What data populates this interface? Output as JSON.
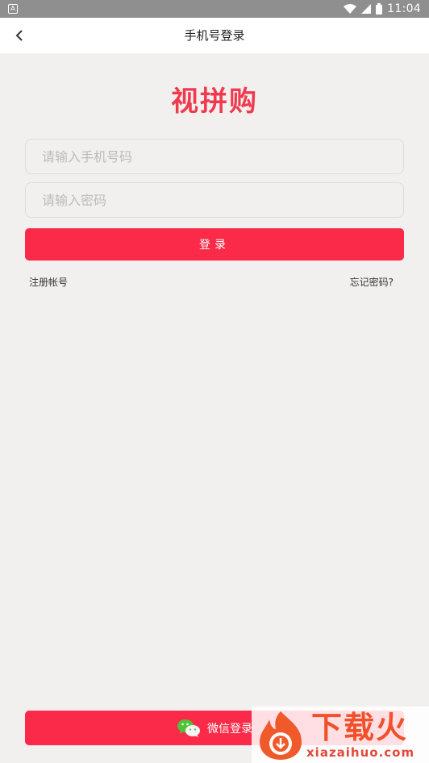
{
  "status_bar": {
    "notification_icon": "A",
    "time": "11:04",
    "icons": [
      "wifi-icon",
      "signal-icon",
      "battery-icon"
    ]
  },
  "header": {
    "title": "手机号登录",
    "back_icon": "chevron-left-icon"
  },
  "logo": {
    "text": "视拼购",
    "color": "#f03a4f"
  },
  "form": {
    "phone_placeholder": "请输入手机号码",
    "phone_value": "",
    "password_placeholder": "请输入密码",
    "password_value": "",
    "login_label": "登录",
    "register_label": "注册帐号",
    "forgot_label": "忘记密码?"
  },
  "wechat": {
    "label": "微信登录",
    "icon": "wechat-icon"
  },
  "watermark": {
    "title": "下载火",
    "domain": "xiazaihuo.com"
  },
  "colors": {
    "accent": "#fa2a48",
    "background": "#f2f0ef",
    "status_bar": "#8f8f8f"
  }
}
